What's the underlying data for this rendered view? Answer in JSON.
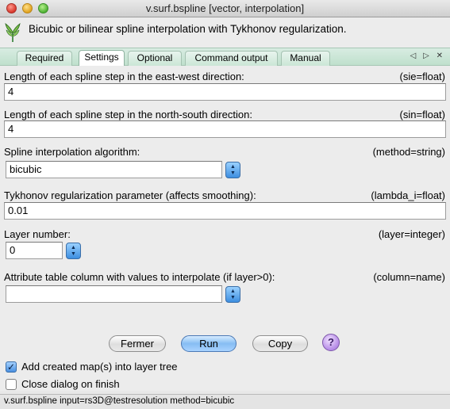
{
  "window": {
    "title": "v.surf.bspline [vector, interpolation]"
  },
  "header": {
    "icon": "grass-icon",
    "description": "Bicubic or bilinear spline interpolation with Tykhonov regularization."
  },
  "tabs": [
    {
      "label": "Required",
      "active": false
    },
    {
      "label": "Settings",
      "active": true
    },
    {
      "label": "Optional",
      "active": false
    },
    {
      "label": "Command output",
      "active": false
    },
    {
      "label": "Manual",
      "active": false
    }
  ],
  "tab_nav": {
    "left_icon": "tab-prev-icon",
    "right_icon": "tab-next-icon",
    "arrows": "◁ ▷ ✕"
  },
  "params": {
    "sie": {
      "label": "Length of each spline step in the east-west direction:",
      "key": "(sie=float)",
      "value": "4"
    },
    "sin": {
      "label": "Length of each spline step in the north-south direction:",
      "key": "(sin=float)",
      "value": "4"
    },
    "method": {
      "label": "Spline interpolation algorithm:",
      "key": "(method=string)",
      "value": "bicubic",
      "options": [
        "bicubic"
      ]
    },
    "lambda": {
      "label": "Tykhonov regularization parameter (affects smoothing):",
      "key": "(lambda_i=float)",
      "value": "0.01"
    },
    "layer": {
      "label": "Layer number:",
      "key": "(layer=integer)",
      "value": "0"
    },
    "column": {
      "label": "Attribute table column with values to interpolate (if layer>0):",
      "key": "(column=name)",
      "value": ""
    }
  },
  "buttons": {
    "close": "Fermer",
    "run": "Run",
    "copy": "Copy",
    "help": "?"
  },
  "options": {
    "add_to_tree": {
      "label": "Add created map(s) into layer tree",
      "checked": true
    },
    "close_on_finish": {
      "label": "Close dialog on finish",
      "checked": false
    }
  },
  "status": "v.surf.bspline input=rs3D@testresolution method=bicubic",
  "colors": {
    "tab_bar": "#bfe0cd",
    "run_button": "#86bdf3",
    "help_button": "#b58ae6"
  }
}
